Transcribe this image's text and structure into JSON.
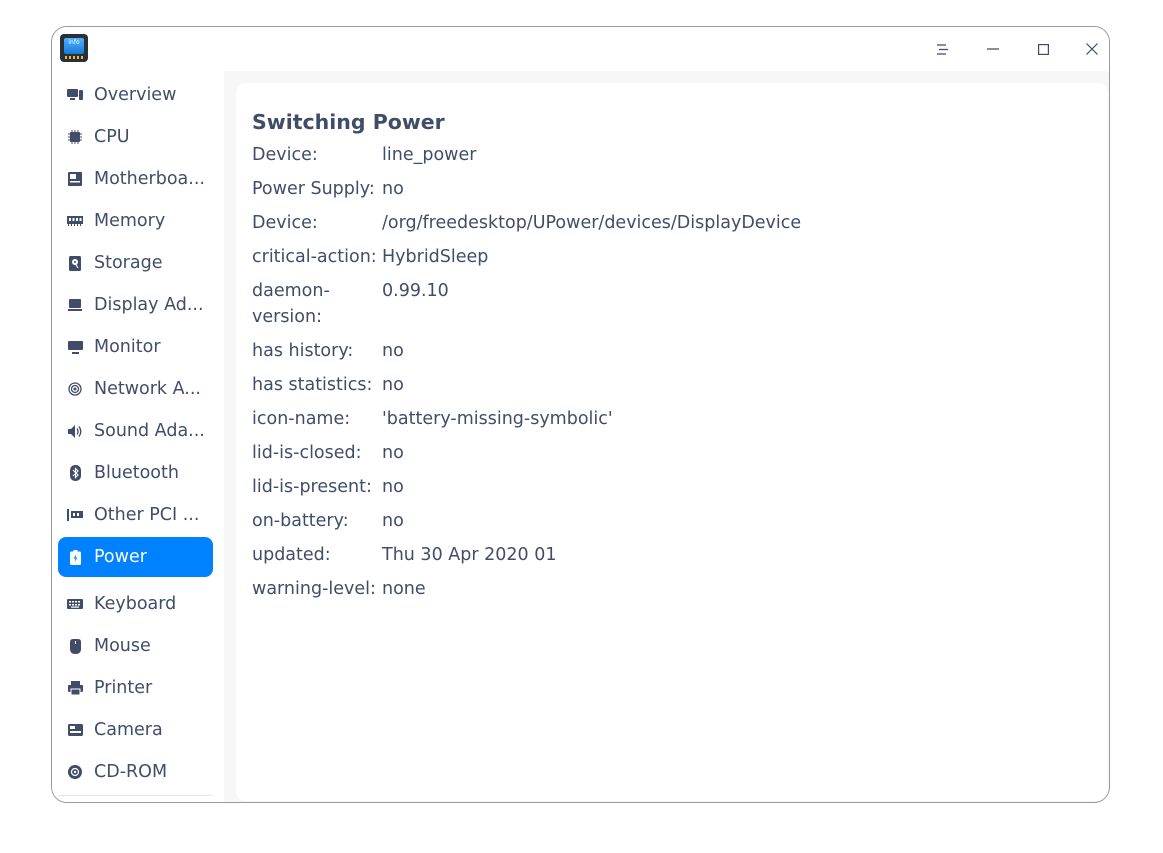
{
  "app": {
    "icon_name": "device-manager-icon",
    "icon_text": "info"
  },
  "window_controls": {
    "menu_icon": "menu-icon",
    "minimize_icon": "minimize-icon",
    "maximize_icon": "maximize-icon",
    "close_icon": "close-icon"
  },
  "sidebar": {
    "active_color": "#0081ff",
    "items": [
      {
        "label": "Overview",
        "icon": "overview-icon"
      },
      {
        "label": "CPU",
        "icon": "cpu-icon"
      },
      {
        "label": "Motherboa...",
        "icon": "motherboard-icon"
      },
      {
        "label": "Memory",
        "icon": "memory-icon"
      },
      {
        "label": "Storage",
        "icon": "storage-icon"
      },
      {
        "label": "Display Ad...",
        "icon": "display-adapter-icon"
      },
      {
        "label": "Monitor",
        "icon": "monitor-icon"
      },
      {
        "label": "Network A...",
        "icon": "network-icon"
      },
      {
        "label": "Sound Ada...",
        "icon": "sound-icon"
      },
      {
        "label": "Bluetooth",
        "icon": "bluetooth-icon"
      },
      {
        "label": "Other PCI ...",
        "icon": "pci-icon"
      },
      {
        "label": "Power",
        "icon": "power-icon",
        "active": true
      },
      {
        "label": "Keyboard",
        "icon": "keyboard-icon"
      },
      {
        "label": "Mouse",
        "icon": "mouse-icon"
      },
      {
        "label": "Printer",
        "icon": "printer-icon"
      },
      {
        "label": "Camera",
        "icon": "camera-icon"
      },
      {
        "label": "CD-ROM",
        "icon": "cdrom-icon"
      }
    ]
  },
  "content": {
    "title": "Switching Power",
    "rows": [
      {
        "key": "Device:",
        "value": "line_power"
      },
      {
        "key": "Power Supply:",
        "value": "no"
      },
      {
        "key": "Device:",
        "value": "/org/freedesktop/UPower/devices/DisplayDevice"
      },
      {
        "key": "critical-action:",
        "value": "HybridSleep"
      },
      {
        "key": "daemon-version:",
        "value": "0.99.10"
      },
      {
        "key": "has history:",
        "value": "no"
      },
      {
        "key": "has statistics:",
        "value": "no"
      },
      {
        "key": "icon-name:",
        "value": "'battery-missing-symbolic'"
      },
      {
        "key": "lid-is-closed:",
        "value": "no"
      },
      {
        "key": "lid-is-present:",
        "value": "no"
      },
      {
        "key": "on-battery:",
        "value": "no"
      },
      {
        "key": "updated:",
        "value": "Thu 30 Apr 2020 01"
      },
      {
        "key": "warning-level:",
        "value": "none"
      }
    ]
  }
}
